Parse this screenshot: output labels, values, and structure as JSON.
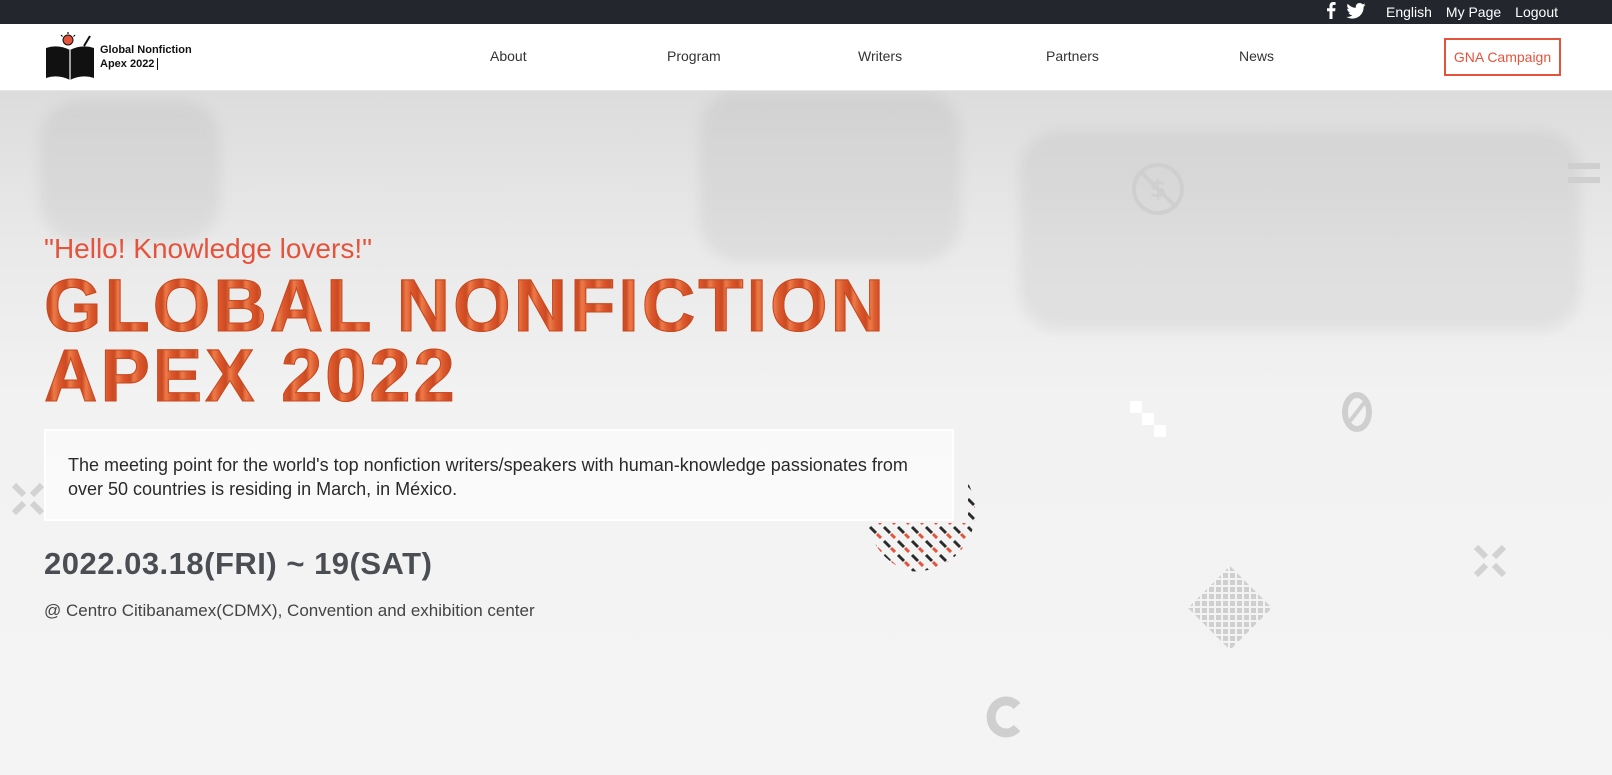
{
  "topbar": {
    "language": "English",
    "my_page": "My Page",
    "logout": "Logout"
  },
  "header": {
    "logo_line1": "Global Nonfiction",
    "logo_line2": "Apex 2022",
    "nav": [
      "About",
      "Program",
      "Writers",
      "Partners",
      "News"
    ],
    "campaign": "GNA Campaign"
  },
  "hero": {
    "greeting": "\"Hello! Knowledge lovers!\"",
    "title_line1": "GLOBAL NONFICTION",
    "title_line2": "APEX 2022",
    "description": "The meeting point for the world's top nonfiction writers/speakers with human-knowledge passionates from over 50 countries is residing in March, in México.",
    "date": "2022.03.18(FRI) ~ 19(SAT)",
    "venue": "@ Centro Citibanamex(CDMX), Convention and exhibition center"
  },
  "colors": {
    "accent": "#e5533d",
    "topbar_bg": "#23262d",
    "title_fill": "#e0552c",
    "date_text": "#4a4d52"
  },
  "icons": [
    "facebook-icon",
    "twitter-icon",
    "book-logo-icon",
    "no-dollar-icon",
    "menu-lines-icon",
    "close-x-icon",
    "dotted-diamond-icon",
    "crossmark-pattern-icon"
  ]
}
